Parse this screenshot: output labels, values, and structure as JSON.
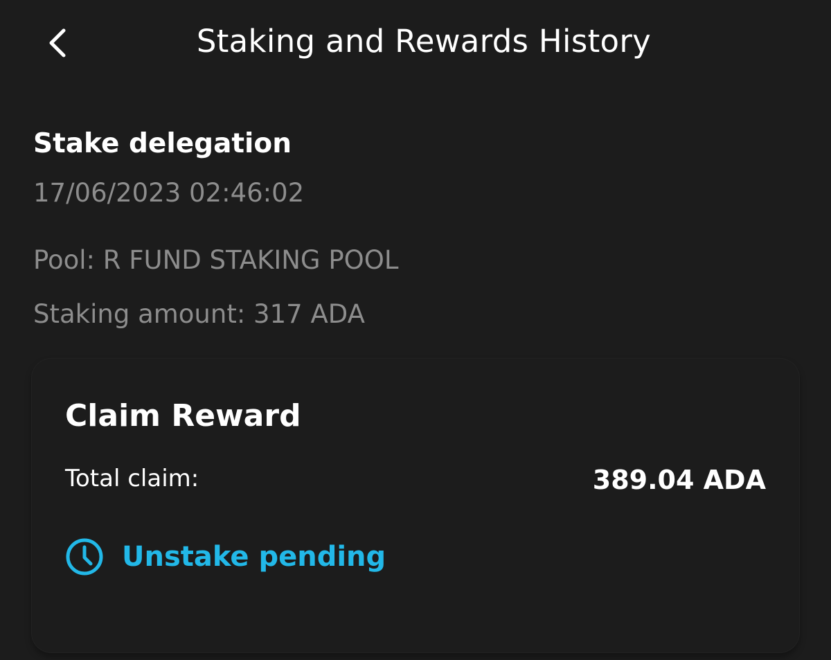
{
  "header": {
    "title": "Staking and Rewards History",
    "back_icon": "chevron-left-icon"
  },
  "delegation": {
    "title": "Stake delegation",
    "timestamp": "17/06/2023 02:46:02",
    "pool": "Pool: R FUND STAKING POOL",
    "staking_amount": "Staking amount: 317 ADA"
  },
  "claim": {
    "title": "Claim Reward",
    "total_label": "Total claim:",
    "total_value": "389.04 ADA",
    "status_text": "Unstake pending",
    "status_icon": "clock-icon",
    "status_color": "#22b8e8"
  },
  "colors": {
    "background": "#1c1c1c",
    "primary_text": "#ffffff",
    "secondary_text": "#8d8d8d",
    "accent": "#22b8e8"
  }
}
